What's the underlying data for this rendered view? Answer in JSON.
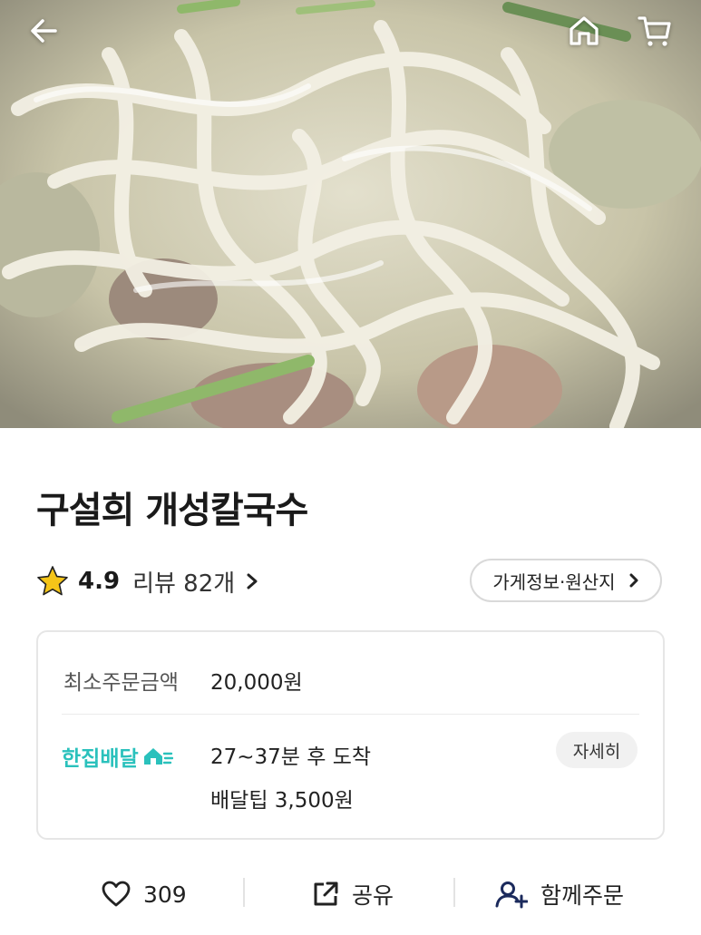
{
  "header": {
    "back_icon": "arrow-left-icon",
    "home_icon": "home-icon",
    "cart_icon": "cart-icon"
  },
  "store": {
    "name": "구설희 개성칼국수",
    "rating": "4.9",
    "review_label": "리뷰 82개",
    "info_button": "가게정보·원산지"
  },
  "order_info": {
    "min_order_label": "최소주문금액",
    "min_order_value": "20,000원",
    "delivery_type": "한집배달",
    "eta": "27~37분 후 도착",
    "delivery_tip": "배달팁 3,500원",
    "detail_button": "자세히"
  },
  "actions": {
    "like_count": "309",
    "share_label": "공유",
    "group_order_label": "함께주문"
  },
  "colors": {
    "brand_teal": "#2ac1bc",
    "star": "#f5c518"
  }
}
